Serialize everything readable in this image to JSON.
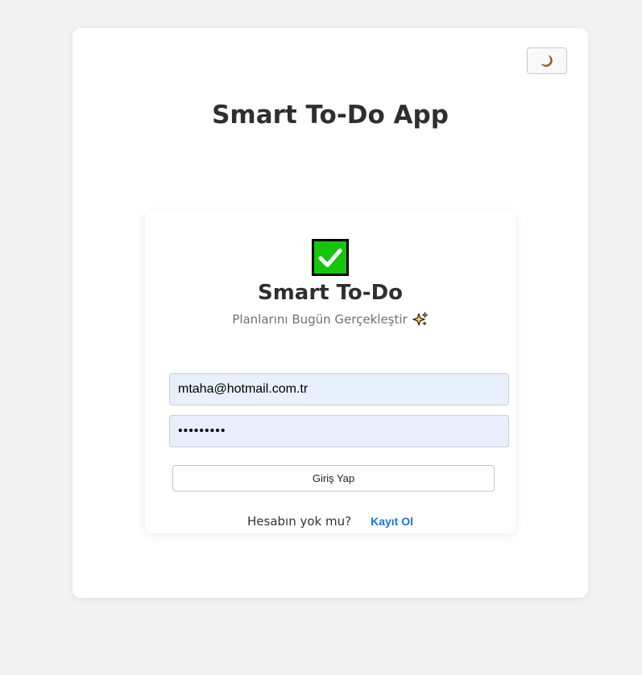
{
  "header": {
    "title": "Smart To-Do App",
    "theme_toggle_icon": "crescent-moon-icon"
  },
  "login_card": {
    "logo_icon": "check-mark-button-icon",
    "title": "Smart To-Do",
    "subtitle": "Planlarını Bugün Gerçekleştir",
    "subtitle_icon": "sparkles-icon",
    "email": {
      "value": "mtaha@hotmail.com.tr"
    },
    "password": {
      "value": "•••••••••"
    },
    "login_button_label": "Giriş Yap",
    "register_prompt": "Hesabın yok mu?",
    "register_link_label": "Kayıt Ol"
  },
  "colors": {
    "page_background": "#f3f3f3",
    "input_background": "#e8f0fe",
    "link": "#1a73e8",
    "check_green": "#16c60c"
  }
}
